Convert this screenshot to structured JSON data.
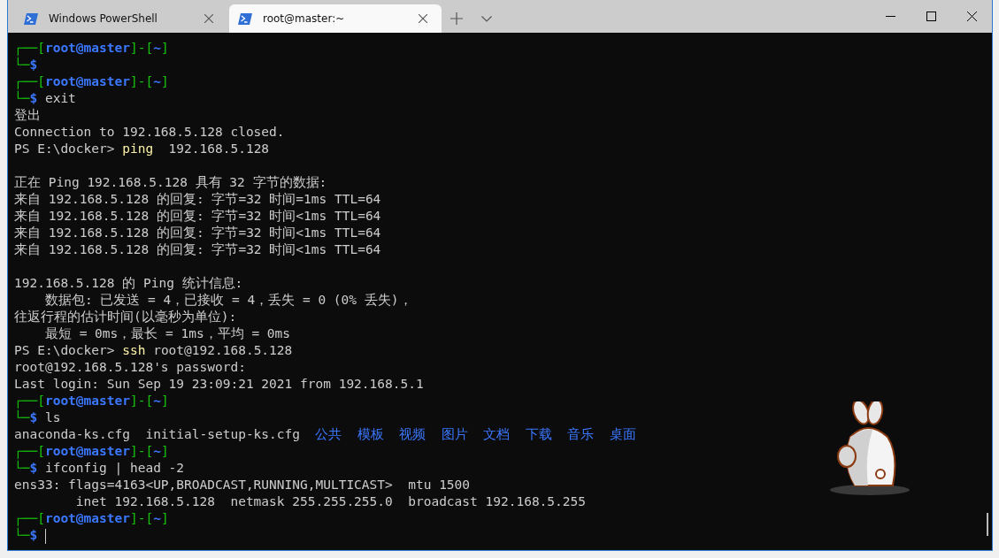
{
  "window": {
    "tabs": [
      {
        "label": "Windows PowerShell",
        "selected": false
      },
      {
        "label": "root@master:~",
        "selected": true
      }
    ]
  },
  "terminal": {
    "lines": [
      {
        "kind": "text",
        "segments": [
          {
            "kind": "frame",
            "text": "┌──["
          },
          {
            "kind": "host",
            "text": "root@master"
          },
          {
            "kind": "frame",
            "text": "]-["
          },
          {
            "kind": "host",
            "text": "~"
          },
          {
            "kind": "frame",
            "text": "]"
          }
        ]
      },
      {
        "kind": "text",
        "segments": [
          {
            "kind": "frame",
            "text": "└─"
          },
          {
            "kind": "host",
            "text": "$"
          }
        ]
      },
      {
        "kind": "text",
        "segments": [
          {
            "kind": "frame",
            "text": "┌──["
          },
          {
            "kind": "host",
            "text": "root@master"
          },
          {
            "kind": "frame",
            "text": "]-["
          },
          {
            "kind": "host",
            "text": "~"
          },
          {
            "kind": "frame",
            "text": "]"
          }
        ]
      },
      {
        "kind": "text",
        "segments": [
          {
            "kind": "frame",
            "text": "└─"
          },
          {
            "kind": "host",
            "text": "$"
          },
          {
            "kind": "text",
            "text": " exit"
          }
        ]
      },
      {
        "kind": "text",
        "segments": [
          {
            "kind": "text",
            "text": "登出"
          }
        ]
      },
      {
        "kind": "text",
        "segments": [
          {
            "kind": "text",
            "text": "Connection to 192.168.5.128 closed."
          }
        ]
      },
      {
        "kind": "text",
        "segments": [
          {
            "kind": "text",
            "text": "PS E:\\docker> "
          },
          {
            "kind": "command",
            "text": "ping"
          },
          {
            "kind": "text",
            "text": "  192.168.5.128"
          }
        ]
      },
      {
        "kind": "blank"
      },
      {
        "kind": "text",
        "segments": [
          {
            "kind": "text",
            "text": "正在 Ping 192.168.5.128 具有 32 字节的数据:"
          }
        ]
      },
      {
        "kind": "text",
        "segments": [
          {
            "kind": "text",
            "text": "来自 192.168.5.128 的回复: 字节=32 时间=1ms TTL=64"
          }
        ]
      },
      {
        "kind": "text",
        "segments": [
          {
            "kind": "text",
            "text": "来自 192.168.5.128 的回复: 字节=32 时间<1ms TTL=64"
          }
        ]
      },
      {
        "kind": "text",
        "segments": [
          {
            "kind": "text",
            "text": "来自 192.168.5.128 的回复: 字节=32 时间<1ms TTL=64"
          }
        ]
      },
      {
        "kind": "text",
        "segments": [
          {
            "kind": "text",
            "text": "来自 192.168.5.128 的回复: 字节=32 时间<1ms TTL=64"
          }
        ]
      },
      {
        "kind": "blank"
      },
      {
        "kind": "text",
        "segments": [
          {
            "kind": "text",
            "text": "192.168.5.128 的 Ping 统计信息:"
          }
        ]
      },
      {
        "kind": "text",
        "segments": [
          {
            "kind": "text",
            "text": "    数据包: 已发送 = 4，已接收 = 4，丢失 = 0 (0% 丢失)，"
          }
        ]
      },
      {
        "kind": "text",
        "segments": [
          {
            "kind": "text",
            "text": "往返行程的估计时间(以毫秒为单位):"
          }
        ]
      },
      {
        "kind": "text",
        "segments": [
          {
            "kind": "text",
            "text": "    最短 = 0ms，最长 = 1ms，平均 = 0ms"
          }
        ]
      },
      {
        "kind": "text",
        "segments": [
          {
            "kind": "text",
            "text": "PS E:\\docker> "
          },
          {
            "kind": "command",
            "text": "ssh"
          },
          {
            "kind": "text",
            "text": " root@192.168.5.128"
          }
        ]
      },
      {
        "kind": "text",
        "segments": [
          {
            "kind": "text",
            "text": "root@192.168.5.128's password:"
          }
        ]
      },
      {
        "kind": "text",
        "segments": [
          {
            "kind": "text",
            "text": "Last login: Sun Sep 19 23:09:21 2021 from 192.168.5.1"
          }
        ]
      },
      {
        "kind": "text",
        "segments": [
          {
            "kind": "frame",
            "text": "┌──["
          },
          {
            "kind": "host",
            "text": "root@master"
          },
          {
            "kind": "frame",
            "text": "]-["
          },
          {
            "kind": "host",
            "text": "~"
          },
          {
            "kind": "frame",
            "text": "]"
          }
        ]
      },
      {
        "kind": "text",
        "segments": [
          {
            "kind": "frame",
            "text": "└─"
          },
          {
            "kind": "host",
            "text": "$"
          },
          {
            "kind": "text",
            "text": " ls"
          }
        ]
      },
      {
        "kind": "text",
        "segments": [
          {
            "kind": "text",
            "text": "anaconda-ks.cfg  initial-setup-ks.cfg  "
          },
          {
            "kind": "directory",
            "text": "公共  "
          },
          {
            "kind": "directory",
            "text": "模板  "
          },
          {
            "kind": "directory",
            "text": "视频  "
          },
          {
            "kind": "directory",
            "text": "图片  "
          },
          {
            "kind": "directory",
            "text": "文档  "
          },
          {
            "kind": "directory",
            "text": "下载  "
          },
          {
            "kind": "directory",
            "text": "音乐  "
          },
          {
            "kind": "directory",
            "text": "桌面"
          }
        ]
      },
      {
        "kind": "text",
        "segments": [
          {
            "kind": "frame",
            "text": "┌──["
          },
          {
            "kind": "host",
            "text": "root@master"
          },
          {
            "kind": "frame",
            "text": "]-["
          },
          {
            "kind": "host",
            "text": "~"
          },
          {
            "kind": "frame",
            "text": "]"
          }
        ]
      },
      {
        "kind": "text",
        "segments": [
          {
            "kind": "frame",
            "text": "└─"
          },
          {
            "kind": "host",
            "text": "$"
          },
          {
            "kind": "text",
            "text": " ifconfig | head -2"
          }
        ]
      },
      {
        "kind": "text",
        "segments": [
          {
            "kind": "text",
            "text": "ens33: flags=4163<UP,BROADCAST,RUNNING,MULTICAST>  mtu 1500"
          }
        ]
      },
      {
        "kind": "text",
        "segments": [
          {
            "kind": "text",
            "text": "        inet 192.168.5.128  netmask 255.255.255.0  broadcast 192.168.5.255"
          }
        ]
      },
      {
        "kind": "text",
        "segments": [
          {
            "kind": "frame",
            "text": "┌──["
          },
          {
            "kind": "host",
            "text": "root@master"
          },
          {
            "kind": "frame",
            "text": "]-["
          },
          {
            "kind": "host",
            "text": "~"
          },
          {
            "kind": "frame",
            "text": "]"
          }
        ]
      },
      {
        "kind": "text",
        "cursor": true,
        "segments": [
          {
            "kind": "frame",
            "text": "└─"
          },
          {
            "kind": "host",
            "text": "$"
          }
        ]
      }
    ]
  }
}
